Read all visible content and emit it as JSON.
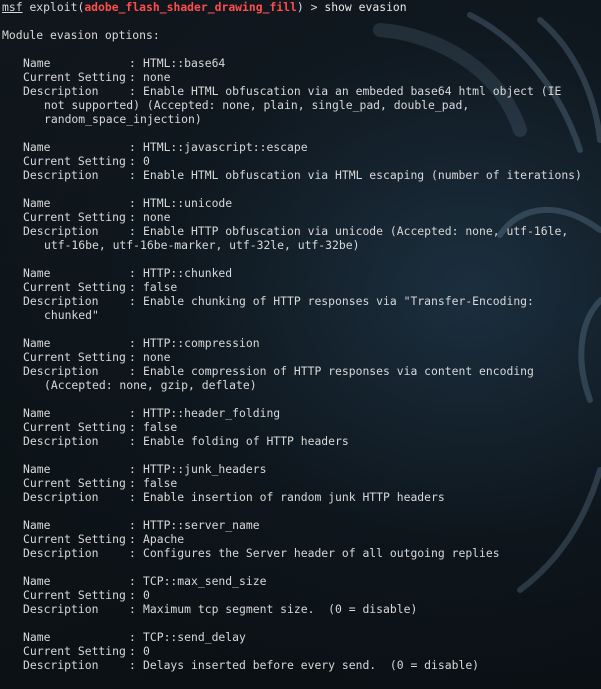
{
  "prompt": {
    "prefix": "msf",
    "exploit_word": "exploit(",
    "exploit_module": "adobe_flash_shader_drawing_fill",
    "close": ")",
    "arrow": " > ",
    "command": "show evasion"
  },
  "heading": "Module evasion options:",
  "labels": {
    "name": "Name",
    "current": "Current Setting",
    "description": "Description",
    "colon": ":"
  },
  "options": [
    {
      "name": "HTML::base64",
      "current": "none",
      "description": [
        "Enable HTML obfuscation via an embeded base64 html object (IE",
        "not supported) (Accepted: none, plain, single_pad, double_pad,",
        "random_space_injection)"
      ]
    },
    {
      "name": "HTML::javascript::escape",
      "current": "0",
      "description": [
        "Enable HTML obfuscation via HTML escaping (number of iterations)"
      ]
    },
    {
      "name": "HTML::unicode",
      "current": "none",
      "description": [
        "Enable HTTP obfuscation via unicode (Accepted: none, utf-16le,",
        "utf-16be, utf-16be-marker, utf-32le, utf-32be)"
      ]
    },
    {
      "name": "HTTP::chunked",
      "current": "false",
      "description": [
        "Enable chunking of HTTP responses via \"Transfer-Encoding:",
        "chunked\""
      ]
    },
    {
      "name": "HTTP::compression",
      "current": "none",
      "description": [
        "Enable compression of HTTP responses via content encoding",
        "(Accepted: none, gzip, deflate)"
      ]
    },
    {
      "name": "HTTP::header_folding",
      "current": "false",
      "description": [
        "Enable folding of HTTP headers"
      ]
    },
    {
      "name": "HTTP::junk_headers",
      "current": "false",
      "description": [
        "Enable insertion of random junk HTTP headers"
      ]
    },
    {
      "name": "HTTP::server_name",
      "current": "Apache",
      "description": [
        "Configures the Server header of all outgoing replies"
      ]
    },
    {
      "name": "TCP::max_send_size",
      "current": "0",
      "description": [
        "Maximum tcp segment size.  (0 = disable)"
      ]
    },
    {
      "name": "TCP::send_delay",
      "current": "0",
      "description": [
        "Delays inserted before every send.  (0 = disable)"
      ]
    }
  ],
  "colors": {
    "background": "#0c1014",
    "text": "#d8d8d8",
    "exploit_module": "#ff4d4d"
  }
}
